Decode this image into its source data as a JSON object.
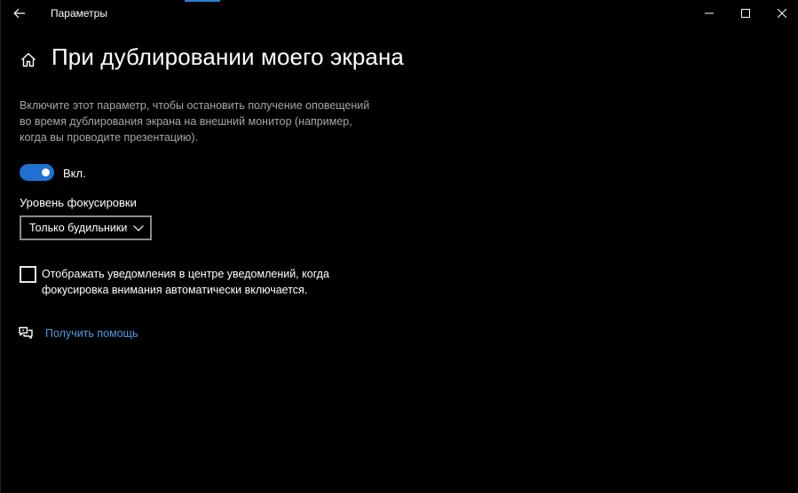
{
  "window": {
    "app_title": "Параметры",
    "icons": {
      "back": "back-arrow-icon",
      "minimize": "minimize-icon",
      "maximize": "maximize-icon",
      "close": "close-icon"
    }
  },
  "header": {
    "home_icon": "home-icon",
    "title": "При дублировании моего экрана"
  },
  "main": {
    "description": "Включите этот параметр, чтобы остановить получение оповещений во время дублирования экрана на внешний монитор (например, когда вы проводите презентацию).",
    "toggle": {
      "state": "on",
      "label": "Вкл."
    },
    "focus_level": {
      "label": "Уровень фокусировки",
      "selected": "Только будильники"
    },
    "show_notifications_checkbox": {
      "checked": false,
      "label": "Отображать уведомления в центре уведомлений, когда фокусировка внимания автоматически включается."
    },
    "help": {
      "icon": "help-chat-icon",
      "link_text": "Получить помощь"
    }
  },
  "colors": {
    "background": "#000000",
    "accent": "#1f70d0",
    "link": "#4a9ee8",
    "secondary_text": "#a6a6a6"
  }
}
